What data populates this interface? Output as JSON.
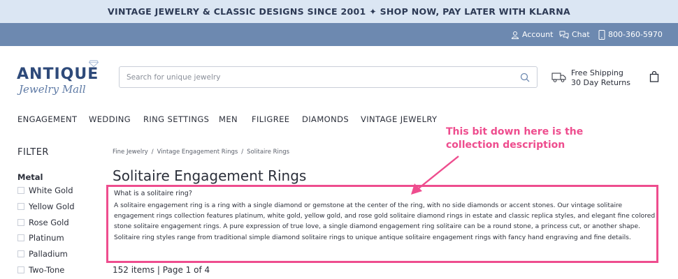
{
  "promo": {
    "text": "VINTAGE JEWELRY & CLASSIC DESIGNS SINCE 2001 ✦ SHOP NOW, PAY LATER WITH KLARNA"
  },
  "utility": {
    "account": "Account",
    "chat": "Chat",
    "phone": "800-360-5970"
  },
  "logo": {
    "main": "ANTIQUE",
    "sub": "Jewelry Mall"
  },
  "search": {
    "placeholder": "Search for unique jewelry",
    "value": ""
  },
  "shipping": {
    "line1": "Free Shipping",
    "line2": "30 Day Returns"
  },
  "nav": {
    "items": [
      {
        "label": "ENGAGEMENT"
      },
      {
        "label": "WEDDING"
      },
      {
        "label": "RING SETTINGS"
      },
      {
        "label": "MEN"
      },
      {
        "label": "FILIGREE"
      },
      {
        "label": "DIAMONDS"
      },
      {
        "label": "VINTAGE JEWELRY"
      }
    ]
  },
  "filter": {
    "title": "FILTER",
    "group_label": "Metal",
    "options": [
      "White Gold",
      "Yellow Gold",
      "Rose Gold",
      "Platinum",
      "Palladium",
      "Two-Tone"
    ]
  },
  "breadcrumb": [
    "Fine Jewelry",
    "Vintage Engagement Rings",
    "Solitaire Rings"
  ],
  "page": {
    "title": "Solitaire Engagement Rings",
    "question": "What is a solitaire ring?",
    "description": "A solitaire engagement ring is a ring with a single diamond or gemstone at the center of the ring, with no side diamonds or accent stones. Our vintage solitaire engagement rings collection features platinum, white gold, yellow gold, and rose gold solitaire diamond rings in estate and classic replica styles, and elegant fine colored stone solitaire engagement rings. A pure expression of true love, a single diamond engagement ring solitaire can be a round stone, a princess cut, or another shape. Solitaire ring styles range from traditional simple diamond solitaire rings to unique antique solitaire engagement rings with fancy hand engraving and fine details.",
    "count": "152 items",
    "pages": "Page 1 of 4"
  },
  "annotation": {
    "line1": "This bit down here is the",
    "line2": "collection description"
  },
  "colors": {
    "promo_bg": "#dbe6f3",
    "utility_bg": "#6d89b0",
    "brand": "#2e4a7a",
    "annotation": "#ee4d8e"
  }
}
